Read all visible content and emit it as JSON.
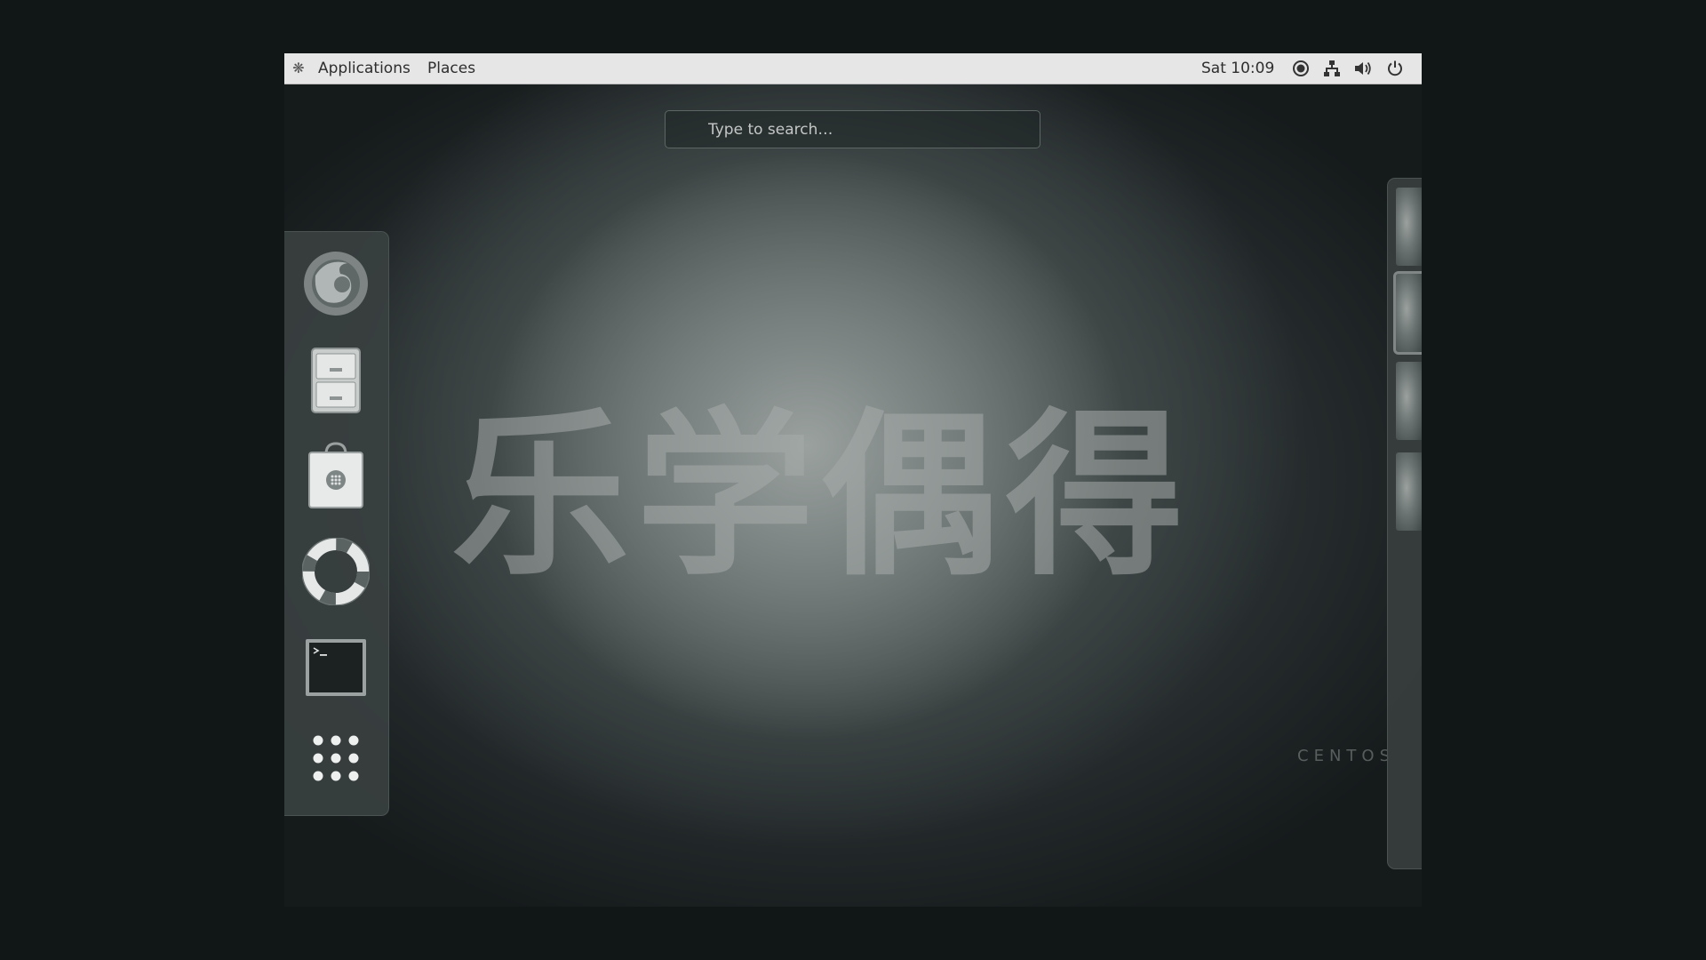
{
  "topbar": {
    "app_icon": "gnome-foot-icon",
    "applications_label": "Applications",
    "places_label": "Places",
    "clock": "Sat 10:09",
    "status_icons": [
      "accessibility-icon",
      "network-icon",
      "volume-icon",
      "power-icon"
    ]
  },
  "search": {
    "placeholder": "Type to search…"
  },
  "dash": {
    "items": [
      {
        "icon": "firefox-icon"
      },
      {
        "icon": "files-icon"
      },
      {
        "icon": "software-icon"
      },
      {
        "icon": "help-icon"
      },
      {
        "icon": "terminal-icon"
      },
      {
        "icon": "show-applications-icon"
      }
    ]
  },
  "workspaces": {
    "count": 4,
    "active_index": 1
  },
  "wallpaper": {
    "watermark": "乐学偶得",
    "brand": "CENTOS"
  },
  "colors": {
    "desktop_bg": "#111617",
    "topbar_bg": "#e6e6e6",
    "dash_bg": "#3a4040"
  }
}
